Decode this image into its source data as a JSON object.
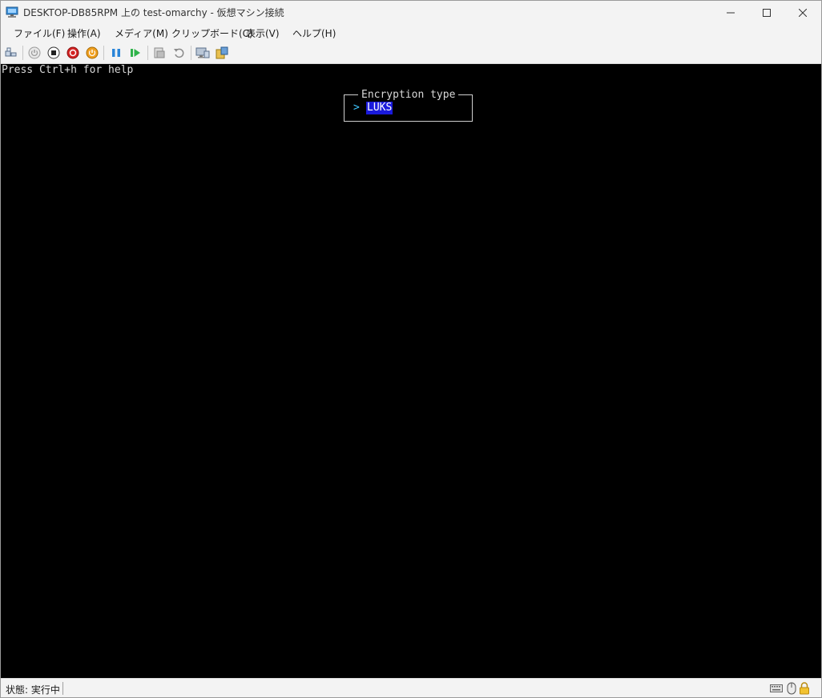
{
  "window": {
    "title": "DESKTOP-DB85RPM 上の test-omarchy  - 仮想マシン接続"
  },
  "menu": {
    "items": [
      {
        "label": "ファイル(F)"
      },
      {
        "label": "操作(A)"
      },
      {
        "label": "メディア(M)"
      },
      {
        "label": "クリップボード(C)"
      },
      {
        "label": "表示(V)"
      },
      {
        "label": "ヘルプ(H)"
      }
    ]
  },
  "toolbar": {
    "icons": [
      "ctrl-alt-del-icon",
      "start-icon",
      "turn-off-icon",
      "shut-down-icon",
      "save-icon",
      "pause-icon",
      "resume-icon",
      "checkpoint-icon",
      "revert-icon",
      "enhanced-session-icon",
      "share-icon"
    ]
  },
  "console": {
    "help_text": "Press Ctrl+h for help",
    "dialog_title": "Encryption type",
    "pointer": ">",
    "selected_option": "LUKS"
  },
  "status": {
    "text": "状態: 実行中"
  },
  "colors": {
    "console_bg": "#000000",
    "selection_bg": "#1a1adc",
    "pointer": "#3fc7ff"
  }
}
